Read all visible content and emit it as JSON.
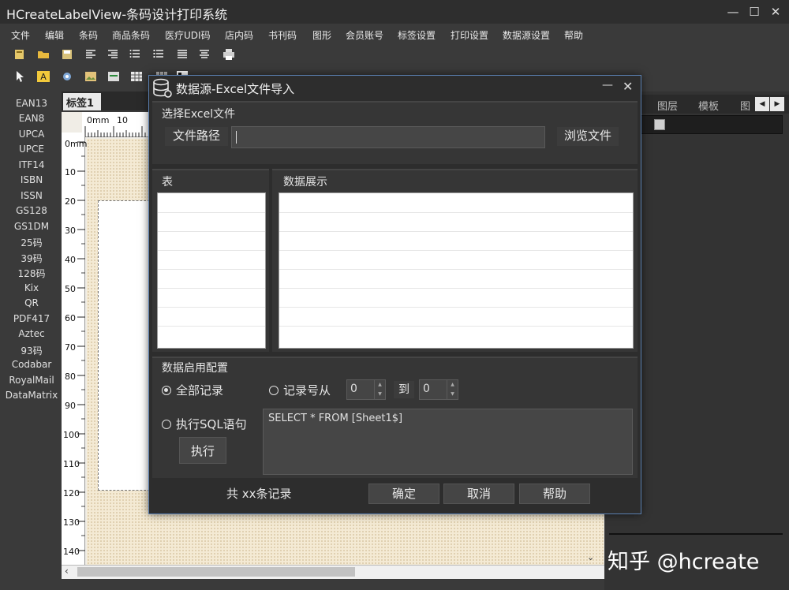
{
  "window": {
    "title": "HCreateLabelView-条码设计打印系统",
    "minimize": "—",
    "maximize": "☐",
    "close": "✕"
  },
  "menu": [
    "文件",
    "编辑",
    "条码",
    "商品条码",
    "医疗UDI码",
    "店内码",
    "书刊码",
    "图形",
    "会员账号",
    "标签设置",
    "打印设置",
    "数据源设置",
    "帮助"
  ],
  "barcode_types": [
    "EAN13",
    "EAN8",
    "UPCA",
    "UPCE",
    "ITF14",
    "ISBN",
    "ISSN",
    "GS128",
    "GS1DM",
    "25码",
    "39码",
    "128码",
    "Kix",
    "QR",
    "PDF417",
    "Aztec",
    "93码",
    "Codabar",
    "RoyalMail",
    "DataMatrix"
  ],
  "canvas": {
    "tab": "标签1",
    "ruler_top": [
      "0mm",
      "10"
    ],
    "ruler_left": [
      "0mm",
      "10",
      "20",
      "30",
      "40",
      "50",
      "60",
      "70",
      "80",
      "90",
      "100",
      "110",
      "120",
      "130",
      "140"
    ]
  },
  "right_panel": {
    "tabs": [
      "图层",
      "模板",
      "图"
    ],
    "scroll_left": "◀",
    "scroll_right": "▶"
  },
  "watermark": "知乎 @hcreate",
  "dialog": {
    "title": "数据源-Excel文件导入",
    "minimize": "—",
    "close": "✕",
    "file_group": {
      "title": "选择Excel文件",
      "path_label": "文件路径",
      "path_value": "",
      "browse": "浏览文件"
    },
    "table_group": {
      "title": "表"
    },
    "data_group": {
      "title": "数据展示"
    },
    "config_group": {
      "title": "数据启用配置",
      "all_records": "全部记录",
      "record_from": "记录号从",
      "from_value": "0",
      "to_label": "到",
      "to_value": "0",
      "sql_label": "执行SQL语句",
      "sql_text": "SELECT * FROM [Sheet1$]",
      "exec": "执行"
    },
    "footer": {
      "count": "共 xx条记录",
      "ok": "确定",
      "cancel": "取消",
      "help": "帮助"
    }
  }
}
